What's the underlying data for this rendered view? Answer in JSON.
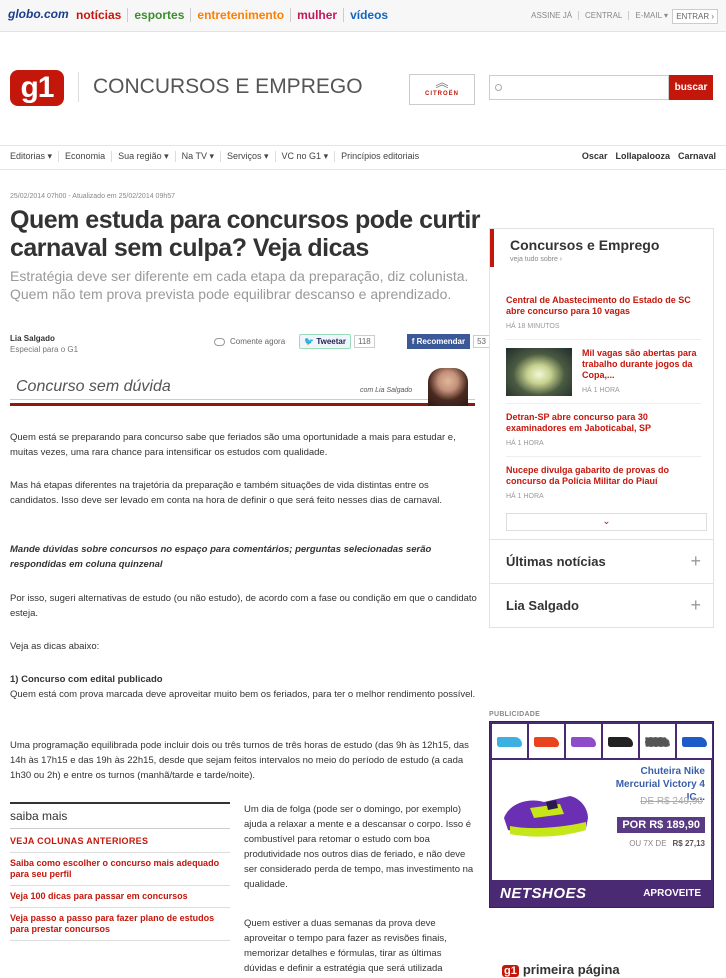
{
  "topbar": {
    "logo": "globo.com",
    "channels": [
      {
        "label": "notícias",
        "color": "#c4170c"
      },
      {
        "label": "esportes",
        "color": "#3c8e2c"
      },
      {
        "label": "entretenimento",
        "color": "#ff7f00"
      },
      {
        "label": "mulher",
        "color": "#c2185b"
      },
      {
        "label": "vídeos",
        "color": "#1565c0"
      }
    ],
    "links": [
      "ASSINE JÁ",
      "CENTRAL",
      "E-MAIL ▾"
    ],
    "login": "ENTRAR ›"
  },
  "header": {
    "logo": "g1",
    "section_title": "CONCURSOS E EMPREGO",
    "sponsor": "CITROËN",
    "search_button": "buscar"
  },
  "nav": {
    "items": [
      "Editorias ▾",
      "Economia",
      "Sua região ▾",
      "Na TV ▾",
      "Serviços ▾",
      "VC no G1 ▾",
      "Princípios editoriais"
    ],
    "right": [
      "Oscar",
      "Lollapalooza",
      "Carnaval"
    ]
  },
  "article": {
    "dateline": "25/02/2014 07h00 - Atualizado em 25/02/2014 09h57",
    "headline": "Quem estuda para concursos pode curtir carnaval sem culpa? Veja dicas",
    "subtitle": "Estratégia deve ser diferente em cada etapa da preparação, diz colunista. Quem não tem prova prevista pode equilibrar descanso e aprendizado.",
    "author": "Lia Salgado",
    "author_role": "Especial para o G1",
    "comment": "Comente agora",
    "tweet": "Tweetar",
    "tweet_count": "118",
    "recommend": "Recomendar",
    "recommend_count": "53",
    "column_title": "Concurso sem dúvida",
    "column_byline": "com Lia Salgado",
    "paragraphs": [
      "Quem está se preparando para concurso sabe que feriados são uma oportunidade a mais para estudar e, muitas vezes, uma rara chance para intensificar os estudos com qualidade.",
      "Mas há etapas diferentes na trajetória da preparação e também situações de vida distintas entre os candidatos. Isso deve ser levado em conta na hora de definir o que será feito nesses dias de carnaval.",
      "Mande dúvidas sobre concursos no espaço para comentários; perguntas selecionadas serão respondidas em coluna quinzenal",
      "Por isso, sugeri alternativas de estudo (ou não estudo), de acordo com a fase ou condição em que o candidato esteja.",
      "Veja as dicas abaixo:",
      "1) Concurso com edital publicado",
      "Quem está com prova marcada deve aproveitar muito bem os feriados, para ter o melhor rendimento possível.",
      "Uma programação equilibrada pode incluir dois ou três turnos de três horas de estudo (das 9h às 12h15, das 14h às 17h15 e das 19h às 22h15, desde que sejam feitos intervalos no meio do período de estudo (a cada 1h30 ou 2h) e entre os turnos (manhã/tarde e tarde/noite).",
      "Um dia de folga (pode ser o domingo, por exemplo) ajuda a relaxar a mente e a descansar o corpo. Isso é combustível para retomar o estudo com boa produtividade nos outros dias de feriado, e não deve ser considerado perda de tempo, mas investimento na qualidade.",
      "Quem estiver a duas semanas da prova deve aproveitar o tempo para fazer as revisões finais, memorizar detalhes e fórmulas, tirar as últimas dúvidas e definir a estratégia que será utilizada"
    ]
  },
  "saiba_mais": {
    "title": "saiba mais",
    "first": "VEJA COLUNAS ANTERIORES",
    "items": [
      "Saiba como escolher o concurso mais adequado para seu perfil",
      "Veja 100 dicas para passar em concursos",
      "Veja passo a passo para fazer plano de estudos para prestar concursos"
    ]
  },
  "sidebar": {
    "title": "Concursos e Emprego",
    "view_all": "veja tudo sobre ›",
    "news": [
      {
        "title": "Central de Abastecimento do Estado de SC abre concurso para 10 vagas",
        "time": "HÁ 18 MINUTOS"
      },
      {
        "title": "Mil vagas são abertas para trabalho durante jogos da Copa,...",
        "time": "HÁ 1 HORA"
      },
      {
        "title": "Detran-SP abre concurso para 30 examinadores em Jaboticabal, SP",
        "time": "HÁ 1 HORA"
      },
      {
        "title": "Nucepe divulga gabarito de provas do concurso da Polícia Militar do Piauí",
        "time": "HÁ 1 HORA"
      }
    ],
    "accordions": [
      {
        "label": "Últimas notícias",
        "icon": "+"
      },
      {
        "label": "Lia Salgado",
        "icon": "+"
      }
    ]
  },
  "ad": {
    "label": "PUBLICIDADE",
    "product": "Chuteira Nike Mercurial Victory 4 IC...",
    "old_price": "DE R$ 249,90",
    "new_price": "POR R$ 189,90",
    "installments_label": "OU 7X DE",
    "installments_value": "R$ 27,13",
    "brand": "NETSHOES",
    "cta": "APROVEITE",
    "thumb_colors": [
      "#3cb0e0",
      "#e8431c",
      "#8e4cc8",
      "#222222",
      "#e8e8e8",
      "#1e5ac8"
    ]
  },
  "footer": {
    "pp_logo": "g1",
    "pp_label": "primeira página"
  }
}
